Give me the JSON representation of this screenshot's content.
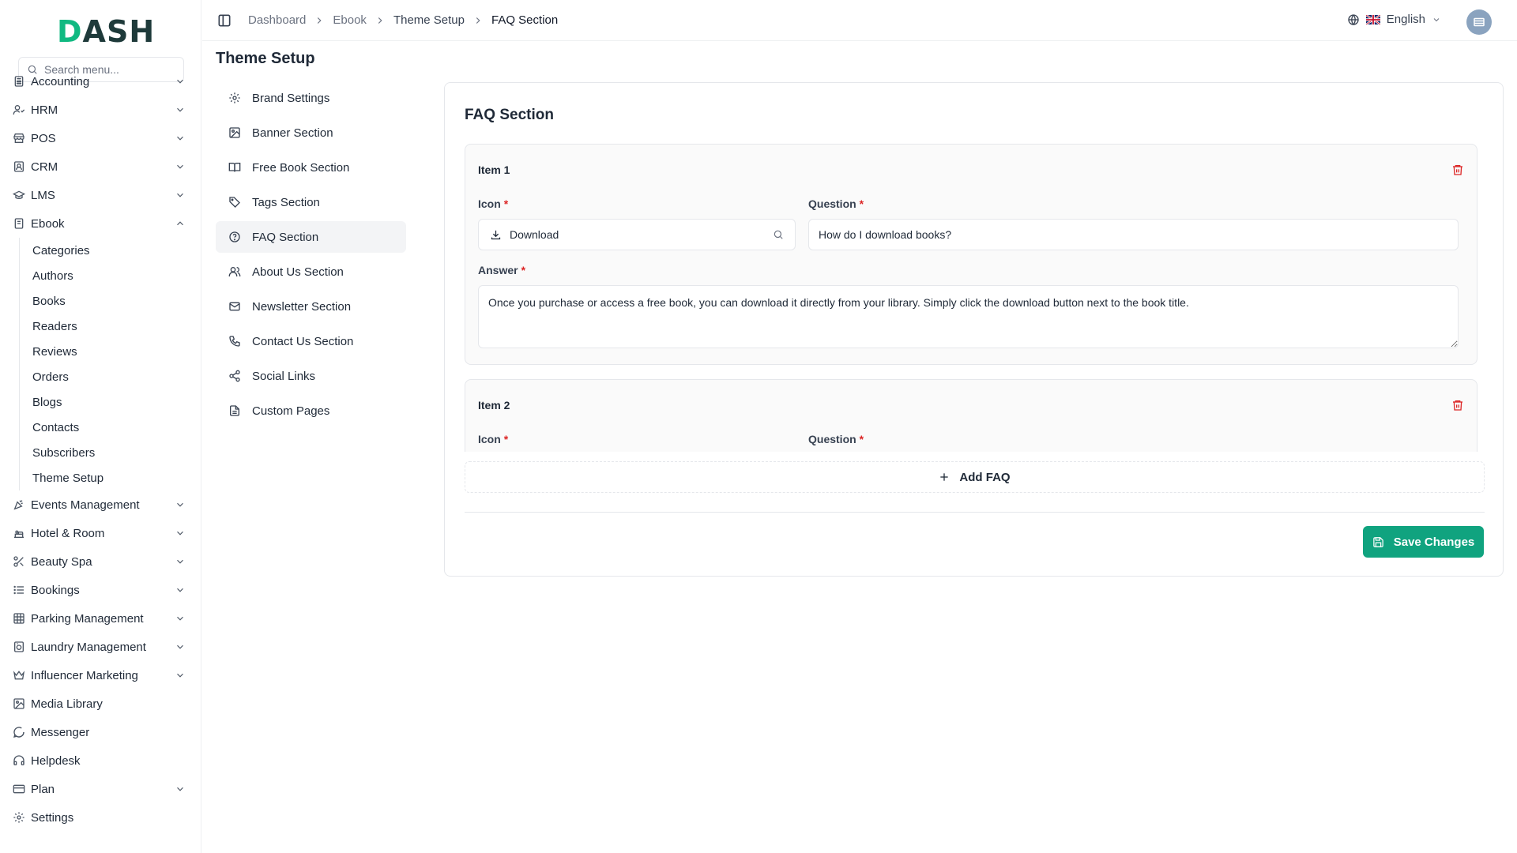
{
  "brand": {
    "logo_text": "DASH",
    "logo_first": "D",
    "logo_rest": "ASH",
    "accent": "#10b981"
  },
  "sidebar": {
    "search_placeholder": "Search menu...",
    "items": [
      {
        "label": "Accounting",
        "icon": "calculator-icon",
        "chevron": "down"
      },
      {
        "label": "HRM",
        "icon": "users-icon",
        "chevron": "down"
      },
      {
        "label": "POS",
        "icon": "store-icon",
        "chevron": "down"
      },
      {
        "label": "CRM",
        "icon": "contact-icon",
        "chevron": "down"
      },
      {
        "label": "LMS",
        "icon": "graduation-cap-icon",
        "chevron": "down"
      },
      {
        "label": "Ebook",
        "icon": "book-icon",
        "chevron": "up"
      }
    ],
    "ebook_sub": [
      "Categories",
      "Authors",
      "Books",
      "Readers",
      "Reviews",
      "Orders",
      "Blogs",
      "Contacts",
      "Subscribers",
      "Theme Setup"
    ],
    "items_after": [
      {
        "label": "Events Management",
        "icon": "party-popper-icon",
        "chevron": "down"
      },
      {
        "label": "Hotel & Room",
        "icon": "hotel-icon",
        "chevron": "down"
      },
      {
        "label": "Beauty Spa",
        "icon": "scissors-icon",
        "chevron": "down"
      },
      {
        "label": "Bookings",
        "icon": "list-icon",
        "chevron": "down"
      },
      {
        "label": "Parking Management",
        "icon": "grid-icon",
        "chevron": "down"
      },
      {
        "label": "Laundry Management",
        "icon": "washing-machine-icon",
        "chevron": "down"
      },
      {
        "label": "Influencer Marketing",
        "icon": "crown-icon",
        "chevron": "down"
      },
      {
        "label": "Media Library",
        "icon": "image-icon",
        "chevron": ""
      },
      {
        "label": "Messenger",
        "icon": "message-icon",
        "chevron": ""
      },
      {
        "label": "Helpdesk",
        "icon": "headphones-icon",
        "chevron": ""
      },
      {
        "label": "Plan",
        "icon": "credit-card-icon",
        "chevron": "down"
      },
      {
        "label": "Settings",
        "icon": "gear-icon",
        "chevron": ""
      }
    ]
  },
  "topbar": {
    "breadcrumb": [
      "Dashboard",
      "Ebook",
      "Theme Setup",
      "FAQ Section"
    ],
    "language": "English"
  },
  "page": {
    "title": "Theme Setup"
  },
  "section_nav": {
    "items": [
      {
        "label": "Brand Settings",
        "icon": "gear-icon",
        "active": false
      },
      {
        "label": "Banner Section",
        "icon": "image-icon",
        "active": false
      },
      {
        "label": "Free Book Section",
        "icon": "book-open-icon",
        "active": false
      },
      {
        "label": "Tags Section",
        "icon": "tag-icon",
        "active": false
      },
      {
        "label": "FAQ Section",
        "icon": "help-circle-icon",
        "active": true
      },
      {
        "label": "About Us Section",
        "icon": "users-icon",
        "active": false
      },
      {
        "label": "Newsletter Section",
        "icon": "mail-icon",
        "active": false
      },
      {
        "label": "Contact Us Section",
        "icon": "phone-icon",
        "active": false
      },
      {
        "label": "Social Links",
        "icon": "share-icon",
        "active": false
      },
      {
        "label": "Custom Pages",
        "icon": "file-text-icon",
        "active": false
      }
    ]
  },
  "faq": {
    "title": "FAQ Section",
    "labels": {
      "icon": "Icon",
      "question": "Question",
      "answer": "Answer",
      "required": "*"
    },
    "items": [
      {
        "title": "Item 1",
        "icon_value": "Download",
        "question": "How do I download books?",
        "answer": "Once you purchase or access a free book, you can download it directly from your library. Simply click the download button next to the book title."
      },
      {
        "title": "Item 2",
        "icon_value": "",
        "question": "",
        "answer": ""
      }
    ],
    "add_label": "Add FAQ",
    "save_label": "Save Changes",
    "save_color": "#10a37f",
    "danger_color": "#dc2626"
  }
}
